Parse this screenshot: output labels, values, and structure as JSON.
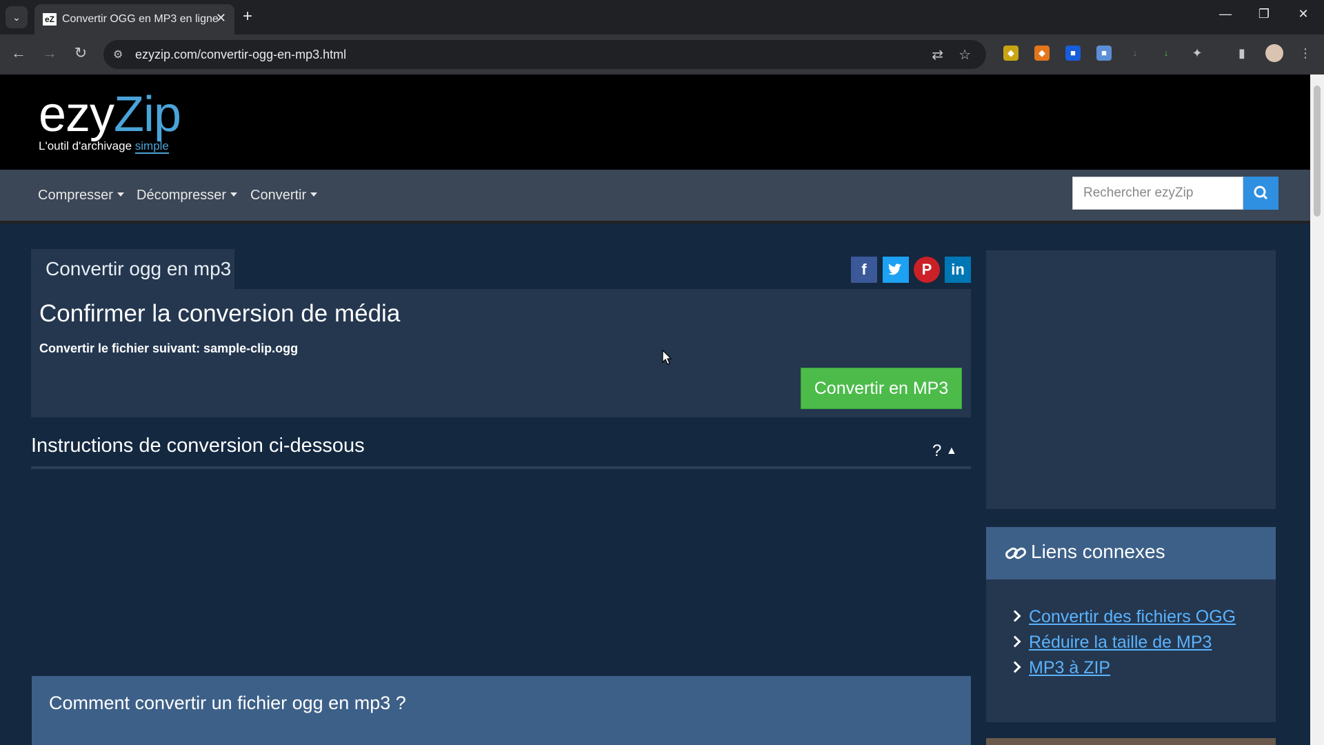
{
  "browser": {
    "tab_title": "Convertir OGG en MP3 en ligne",
    "tab_favicon": "eZ",
    "url": "ezyzip.com/convertir-ogg-en-mp3.html"
  },
  "site": {
    "logo_ezy": "ezy",
    "logo_zip": "Zip",
    "tagline_prefix": "L'outil d'archivage ",
    "tagline_accent": "simple"
  },
  "nav": {
    "items": [
      "Compresser",
      "Décompresser",
      "Convertir"
    ],
    "search_placeholder": "Rechercher ezyZip"
  },
  "tool": {
    "tab_label": "Convertir ogg en mp3",
    "heading": "Confirmer la conversion de média",
    "file_line": "Convertir le fichier suivant: sample-clip.ogg",
    "convert_button": "Convertir en MP3"
  },
  "share": {
    "facebook": "f",
    "pinterest": "P",
    "linkedin": "in"
  },
  "instructions": {
    "title": "Instructions de conversion ci-dessous",
    "toggle": "?"
  },
  "how": {
    "title": "Comment convertir un fichier ogg en mp3 ?"
  },
  "related": {
    "title": "Liens connexes",
    "links": [
      "Convertir des fichiers OGG",
      "Réduire la taille de MP3",
      "MP3 à ZIP"
    ]
  },
  "colors": {
    "page_bg": "#142840",
    "card_bg": "#24374f",
    "accent_blue": "#3d6088",
    "convert_green": "#4cbb4a",
    "link_blue": "#5ab3ff",
    "facebook": "#3b5998",
    "twitter": "#1da1f2",
    "pinterest": "#cb2027",
    "linkedin": "#0077b5"
  }
}
